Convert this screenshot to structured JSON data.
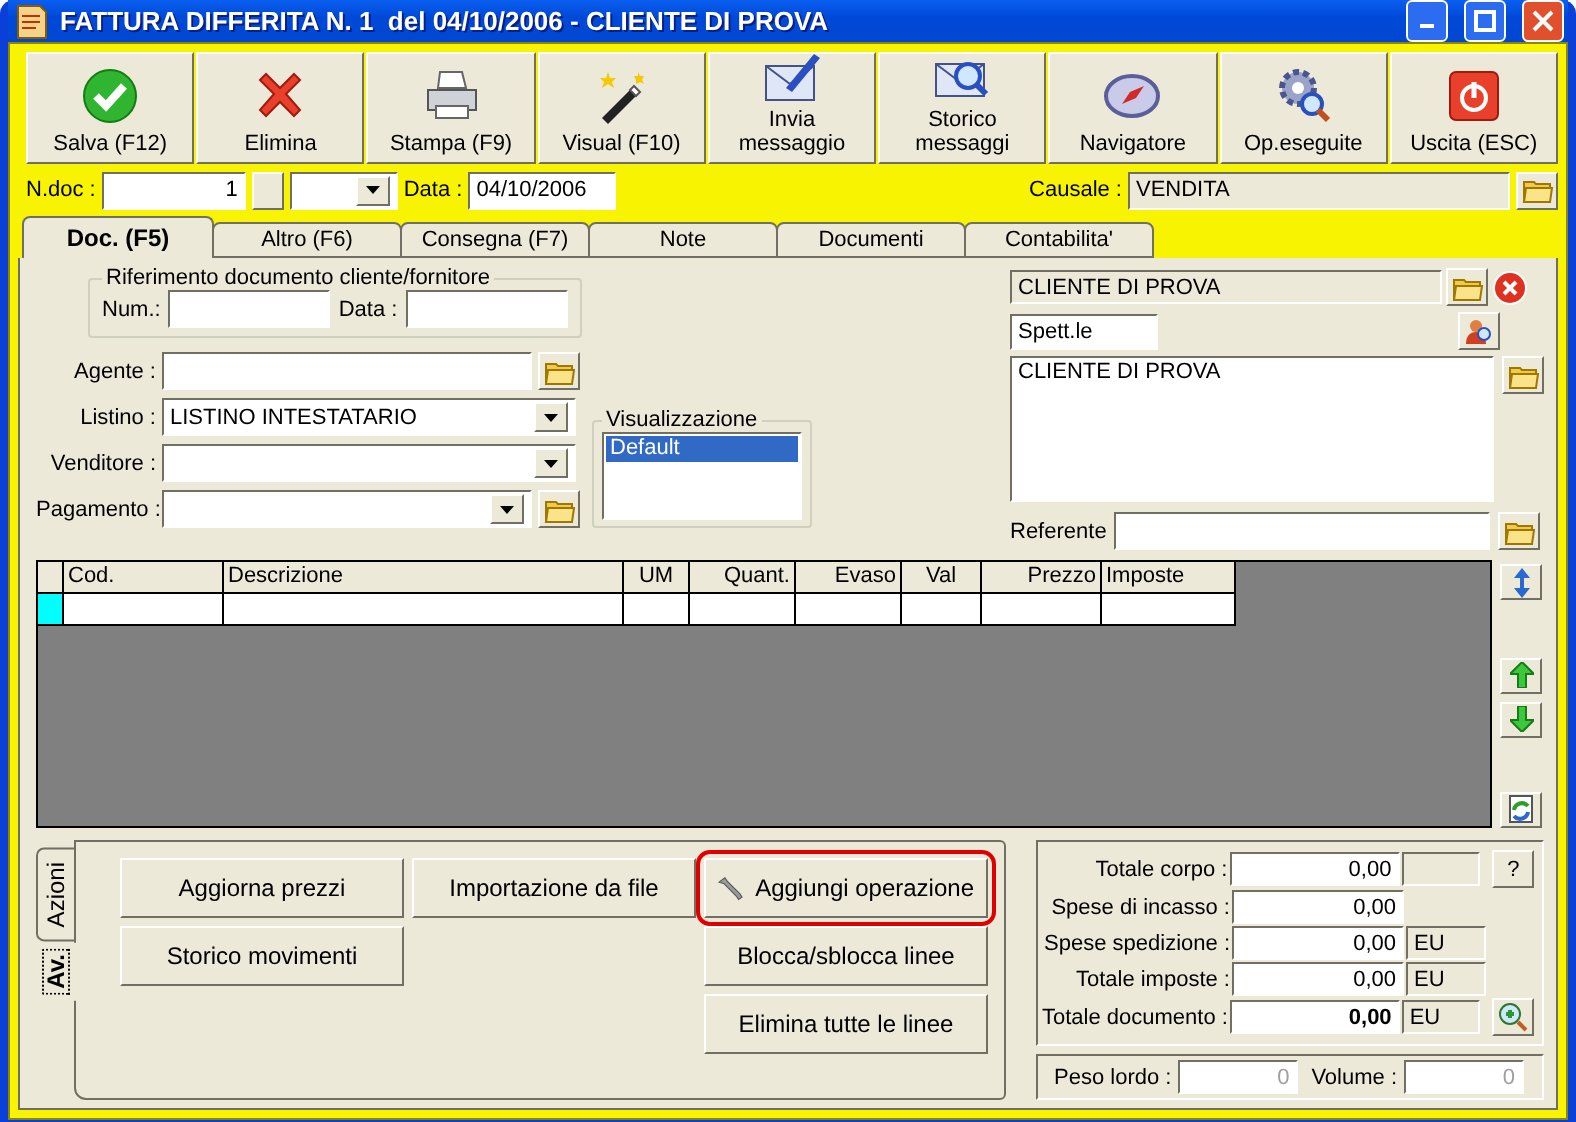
{
  "window": {
    "title": "FATTURA DIFFERITA N. 1  del 04/10/2006 - CLIENTE DI PROVA"
  },
  "toolbar": [
    {
      "lines": [
        "Salva (F12)"
      ],
      "kind": "save"
    },
    {
      "lines": [
        "Elimina"
      ],
      "kind": "delete"
    },
    {
      "lines": [
        "Stampa (F9)"
      ],
      "kind": "print"
    },
    {
      "lines": [
        "Visual (F10)"
      ],
      "kind": "visual"
    },
    {
      "lines": [
        "Invia",
        "messaggio"
      ],
      "kind": "send"
    },
    {
      "lines": [
        "Storico",
        "messaggi"
      ],
      "kind": "history"
    },
    {
      "lines": [
        "Navigatore"
      ],
      "kind": "navigator"
    },
    {
      "lines": [
        "Op.eseguite"
      ],
      "kind": "operations"
    },
    {
      "lines": [
        "Uscita (ESC)"
      ],
      "kind": "exit"
    }
  ],
  "header": {
    "ndoc_label": "N.doc :",
    "ndoc": "1",
    "data_label": "Data :",
    "data": "04/10/2006",
    "causale_label": "Causale :",
    "causale": "VENDITA"
  },
  "tabs": [
    {
      "label": "Doc. (F5)",
      "selected": true
    },
    {
      "label": "Altro (F6)",
      "selected": false
    },
    {
      "label": "Consegna (F7)",
      "selected": false
    },
    {
      "label": "Note",
      "selected": false
    },
    {
      "label": "Documenti",
      "selected": false
    },
    {
      "label": "Contabilita'",
      "selected": false
    }
  ],
  "reference_group": {
    "title": "Riferimento documento cliente/fornitore",
    "num_label": "Num.:",
    "data_label": "Data :"
  },
  "fields": [
    {
      "label": "Agente :",
      "kind": "lookup"
    },
    {
      "label": "Listino :",
      "value": "LISTINO INTESTATARIO",
      "kind": "dropdown"
    },
    {
      "label": "Venditore :",
      "kind": "dropdown"
    },
    {
      "label": "Pagamento :",
      "kind": "dropdown-lookup"
    }
  ],
  "view_group": {
    "title": "Visualizzazione",
    "items": [
      {
        "label": "Default",
        "selected": true
      }
    ]
  },
  "customer": {
    "name": "CLIENTE DI PROVA",
    "salutation": "Spett.le",
    "address": "CLIENTE DI PROVA",
    "referente_label": "Referente"
  },
  "table": {
    "columns": [
      {
        "label": "Cod."
      },
      {
        "label": "Descrizione"
      },
      {
        "label": "UM"
      },
      {
        "label": "Quant."
      },
      {
        "label": "Evaso"
      },
      {
        "label": "Val"
      },
      {
        "label": "Prezzo"
      },
      {
        "label": "Imposte"
      }
    ]
  },
  "actions": {
    "side_tabs": [
      {
        "label": "Azioni",
        "selected": false
      },
      {
        "label": "Av.",
        "selected": true
      }
    ],
    "columns": [
      [
        {
          "label": "Aggiorna prezzi",
          "kind": "plain",
          "highlighted": false
        },
        {
          "label": "Storico movimenti",
          "kind": "plain",
          "highlighted": false
        }
      ],
      [
        {
          "label": "Importazione da file",
          "kind": "plain",
          "highlighted": false
        }
      ],
      [
        {
          "label": "Aggiungi operazione",
          "kind": "tool",
          "highlighted": true
        },
        {
          "label": "Blocca/sblocca linee",
          "kind": "plain",
          "highlighted": false
        },
        {
          "label": "Elimina tutte le linee",
          "kind": "plain",
          "highlighted": false
        }
      ]
    ]
  },
  "totals": [
    {
      "label": "Totale corpo :",
      "value": "0,00",
      "kind": "help",
      "button": "?"
    },
    {
      "label": "Spese di incasso :",
      "value": "0,00",
      "kind": "plain"
    },
    {
      "label": "Spese spedizione :",
      "value": "0,00",
      "kind": "unit",
      "unit": "EU"
    },
    {
      "label": "Totale imposte :",
      "value": "0,00",
      "kind": "unit",
      "unit": "EU"
    },
    {
      "label": "Totale documento :",
      "value": "0,00",
      "kind": "total",
      "unit": "EU"
    }
  ],
  "measures": [
    {
      "label": "Peso lordo :",
      "value": "0",
      "disabled": true
    },
    {
      "label": "Volume :",
      "value": "0",
      "disabled": true
    }
  ]
}
